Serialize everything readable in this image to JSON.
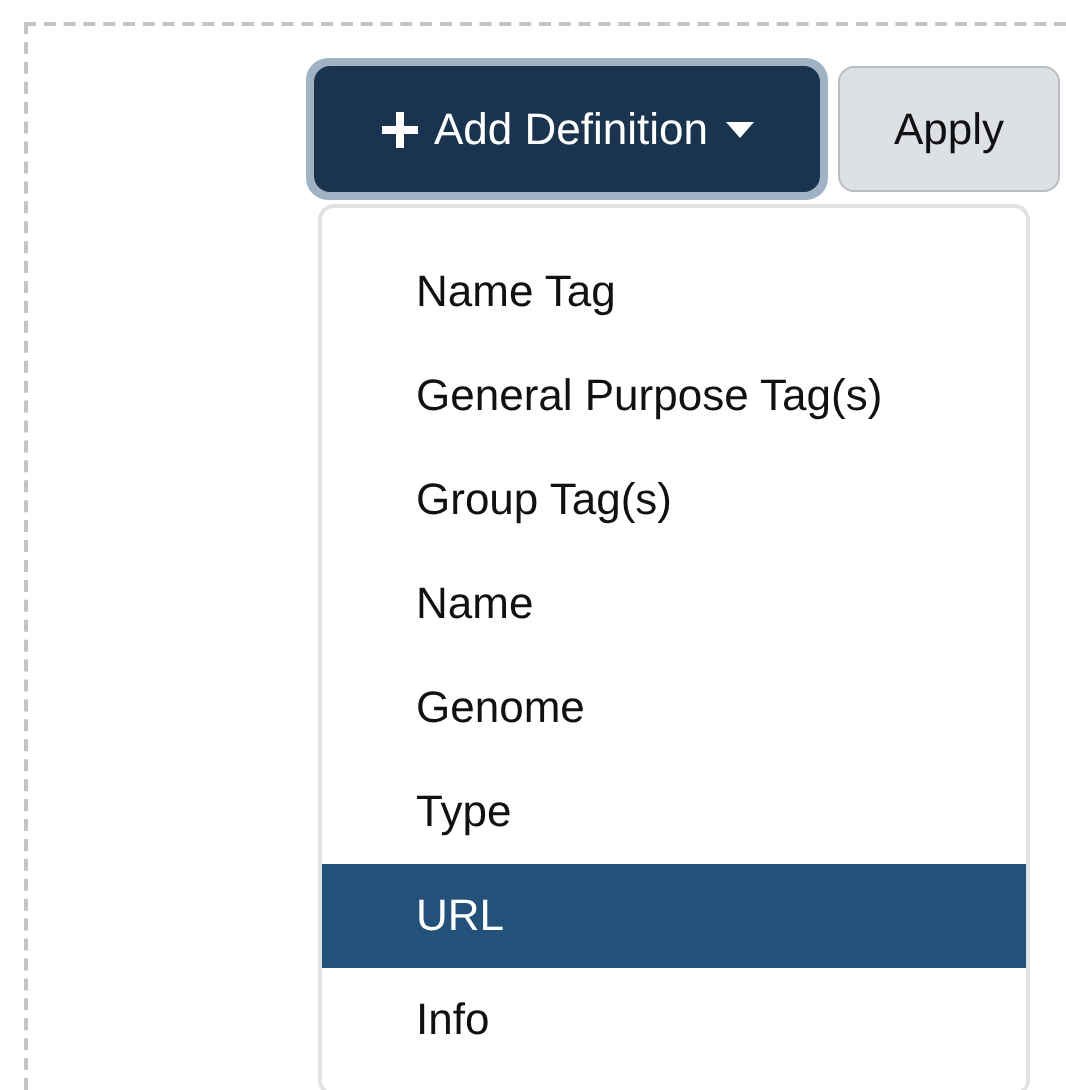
{
  "add_button": {
    "label": "Add Definition"
  },
  "apply_button": {
    "label": "Apply"
  },
  "menu": {
    "items": [
      {
        "label": "Name Tag",
        "selected": false
      },
      {
        "label": "General Purpose Tag(s)",
        "selected": false
      },
      {
        "label": "Group Tag(s)",
        "selected": false
      },
      {
        "label": "Name",
        "selected": false
      },
      {
        "label": "Genome",
        "selected": false
      },
      {
        "label": "Type",
        "selected": false
      },
      {
        "label": "URL",
        "selected": true
      },
      {
        "label": "Info",
        "selected": false
      }
    ]
  }
}
